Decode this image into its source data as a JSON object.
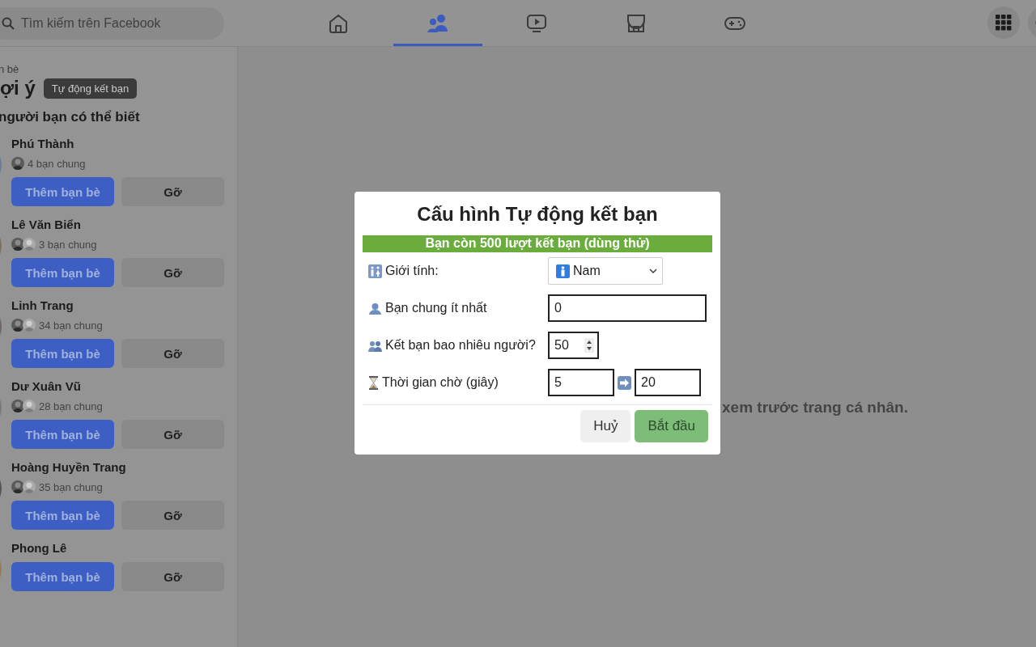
{
  "topbar": {
    "search": {
      "placeholder": "Tìm kiếm trên Facebook"
    },
    "nav_tabs": [
      {
        "kind": "home",
        "selected": false
      },
      {
        "kind": "friends",
        "selected": true
      },
      {
        "kind": "watch",
        "selected": false
      },
      {
        "kind": "marketplace",
        "selected": false
      },
      {
        "kind": "gaming",
        "selected": false
      }
    ],
    "actions": [
      {
        "kind": "menu"
      },
      {
        "kind": "messenger"
      }
    ]
  },
  "sidebar": {
    "breadcrumb": "n bè",
    "heading": "ợi ý",
    "tooltip": "Tự động kết bạn",
    "section_title": "người bạn có thể biết",
    "people": [
      {
        "name": "Phú Thành",
        "mutual": "4 bạn chung",
        "add_label": "Thêm bạn bè",
        "remove_label": "Gỡ"
      },
      {
        "name": "Lê Văn Biển",
        "mutual": "3 bạn chung",
        "add_label": "Thêm bạn bè",
        "remove_label": "Gỡ"
      },
      {
        "name": "Linh Trang",
        "mutual": "34 bạn chung",
        "add_label": "Thêm bạn bè",
        "remove_label": "Gỡ"
      },
      {
        "name": "Dư Xuân Vũ",
        "mutual": "28 bạn chung",
        "add_label": "Thêm bạn bè",
        "remove_label": "Gỡ"
      },
      {
        "name": "Hoàng Huyền Trang",
        "mutual": "35 bạn chung",
        "add_label": "Thêm bạn bè",
        "remove_label": "Gỡ"
      },
      {
        "name": "Phong Lê",
        "add_label": "Thêm bạn bè",
        "remove_label": "Gỡ"
      }
    ]
  },
  "main": {
    "subtitle": "xem trước trang cá nhân."
  },
  "dialog": {
    "title": "Cấu hình Tự động kết bạn",
    "banner": "Bạn còn 500 lượt kết bạn (dùng thử)",
    "fields": [
      {
        "kind": "select",
        "label": "Giới tính:",
        "value": "Nam"
      },
      {
        "kind": "text",
        "label": "Bạn chung ít nhất",
        "value": "0"
      },
      {
        "kind": "number",
        "label": "Kết bạn bao nhiêu người?",
        "value": "50"
      },
      {
        "kind": "range",
        "label": "Thời gian chờ (giây)",
        "from": "5",
        "to": "20"
      }
    ],
    "buttons": [
      {
        "kind": "cancel",
        "label": "Huỷ"
      },
      {
        "kind": "primary",
        "label": "Bắt đầu"
      }
    ]
  }
}
